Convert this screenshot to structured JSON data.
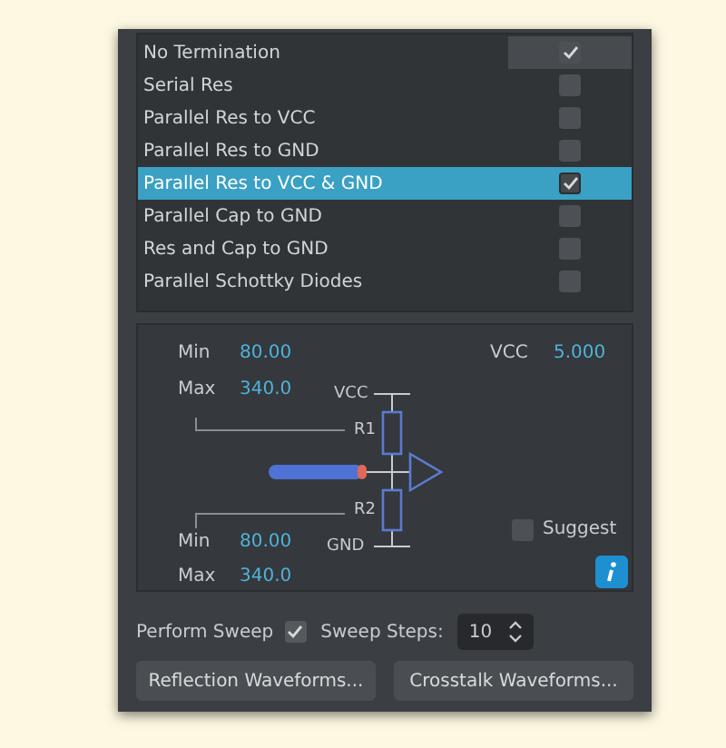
{
  "terminations": [
    {
      "label": "No Termination",
      "checked": true,
      "selected": false,
      "focused": true
    },
    {
      "label": "Serial Res",
      "checked": false,
      "selected": false,
      "focused": false
    },
    {
      "label": "Parallel Res to VCC",
      "checked": false,
      "selected": false,
      "focused": false
    },
    {
      "label": "Parallel Res to GND",
      "checked": false,
      "selected": false,
      "focused": false
    },
    {
      "label": "Parallel Res to VCC & GND",
      "checked": true,
      "selected": true,
      "focused": false
    },
    {
      "label": "Parallel Cap to GND",
      "checked": false,
      "selected": false,
      "focused": false
    },
    {
      "label": "Res and Cap to GND",
      "checked": false,
      "selected": false,
      "focused": false
    },
    {
      "label": "Parallel Schottky Diodes",
      "checked": false,
      "selected": false,
      "focused": false
    }
  ],
  "diagram": {
    "r1": {
      "min_label": "Min",
      "min": "80.00",
      "max_label": "Max",
      "max": "340.0"
    },
    "vcc": {
      "label": "VCC",
      "value": "5.000"
    },
    "r2": {
      "min_label": "Min",
      "min": "80.00",
      "max_label": "Max",
      "max": "340.0"
    },
    "labels": {
      "vcc": "VCC",
      "r1": "R1",
      "r2": "R2",
      "gnd": "GND"
    },
    "suggest": {
      "label": "Suggest",
      "checked": false
    }
  },
  "sweep": {
    "label": "Perform Sweep",
    "checked": true,
    "steps_label": "Sweep Steps:",
    "steps": "10"
  },
  "buttons": [
    "Reflection Waveforms...",
    "Crosstalk Waveforms..."
  ]
}
